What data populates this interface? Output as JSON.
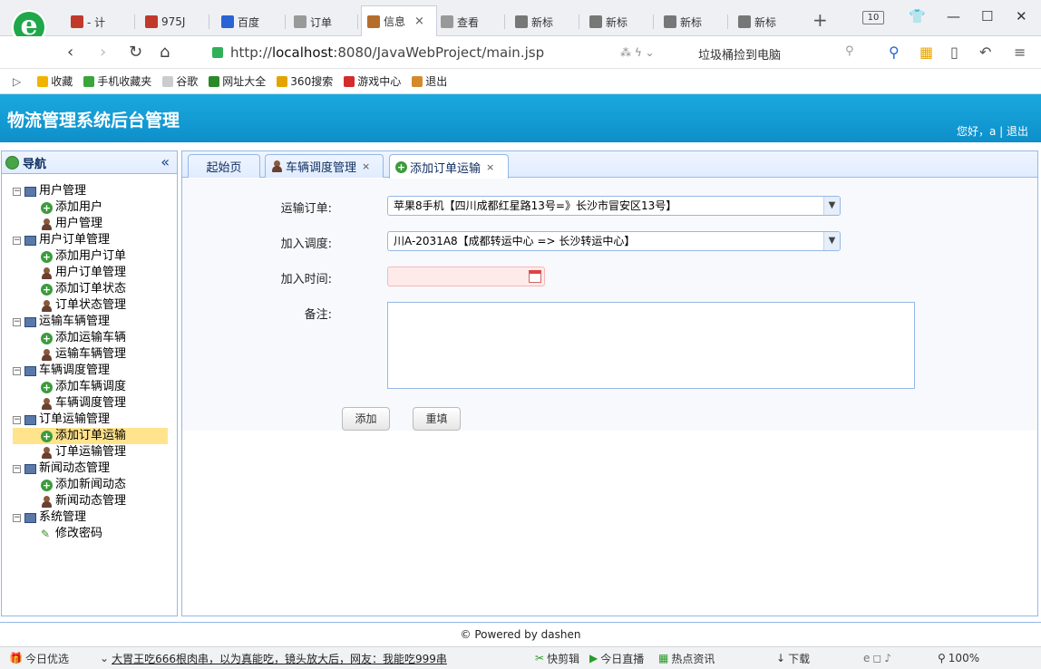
{
  "browser": {
    "tabs": [
      {
        "label": "- 计",
        "color": "#c0392b"
      },
      {
        "label": "975J",
        "color": "#c0392b"
      },
      {
        "label": "百度",
        "color": "#2a63d5"
      },
      {
        "label": "订单",
        "color": "#999999"
      },
      {
        "label": "信息",
        "color": "#b76d2a",
        "close": "×"
      },
      {
        "label": "查看",
        "color": "#999999"
      },
      {
        "label": "新标",
        "color": "#777777"
      },
      {
        "label": "新标",
        "color": "#777777"
      },
      {
        "label": "新标",
        "color": "#777777"
      },
      {
        "label": "新标",
        "color": "#777777"
      }
    ],
    "new_tab": "+",
    "tab_count": "10",
    "url_prefix": "http://",
    "url_host": "localhost",
    "url_rest": ":8080/JavaWebProject/main.jsp",
    "suggestion": "垃圾桶捡到电脑",
    "logo_letter": "e"
  },
  "bookmarks": [
    {
      "label": "收藏",
      "icon": "star-icon",
      "color": "#f0b400"
    },
    {
      "label": "手机收藏夹",
      "icon": "phone-icon",
      "color": "#3aa53a"
    },
    {
      "label": "谷歌",
      "icon": "page-icon",
      "color": "#cccccc"
    },
    {
      "label": "网址大全",
      "icon": "globe-icon",
      "color": "#2a8a2a"
    },
    {
      "label": "360搜索",
      "icon": "search360-icon",
      "color": "#e3a400"
    },
    {
      "label": "游戏中心",
      "icon": "game-icon",
      "color": "#d42c2c"
    },
    {
      "label": "退出",
      "icon": "exit-icon",
      "color": "#d48a2c"
    }
  ],
  "app": {
    "title": "物流管理系统后台管理",
    "greeting": "您好，a",
    "logout": "退出"
  },
  "nav": {
    "title": "导航",
    "collapse": "«",
    "groups": [
      {
        "label": "用户管理",
        "items": [
          {
            "label": "添加用户",
            "icon": "add"
          },
          {
            "label": "用户管理",
            "icon": "user"
          }
        ]
      },
      {
        "label": "用户订单管理",
        "items": [
          {
            "label": "添加用户订单",
            "icon": "add"
          },
          {
            "label": "用户订单管理",
            "icon": "user"
          },
          {
            "label": "添加订单状态",
            "icon": "add"
          },
          {
            "label": "订单状态管理",
            "icon": "user"
          }
        ]
      },
      {
        "label": "运输车辆管理",
        "items": [
          {
            "label": "添加运输车辆",
            "icon": "add"
          },
          {
            "label": "运输车辆管理",
            "icon": "user"
          }
        ]
      },
      {
        "label": "车辆调度管理",
        "items": [
          {
            "label": "添加车辆调度",
            "icon": "add"
          },
          {
            "label": "车辆调度管理",
            "icon": "user"
          }
        ]
      },
      {
        "label": "订单运输管理",
        "items": [
          {
            "label": "添加订单运输",
            "icon": "add",
            "selected": true
          },
          {
            "label": "订单运输管理",
            "icon": "user"
          }
        ]
      },
      {
        "label": "新闻动态管理",
        "items": [
          {
            "label": "添加新闻动态",
            "icon": "add"
          },
          {
            "label": "新闻动态管理",
            "icon": "user"
          }
        ]
      },
      {
        "label": "系统管理",
        "items": [
          {
            "label": "修改密码",
            "icon": "pen"
          }
        ]
      }
    ]
  },
  "content_tabs": [
    {
      "label": "起始页"
    },
    {
      "label": "车辆调度管理",
      "close": "×"
    },
    {
      "label": "添加订单运输",
      "close": "×",
      "active": true
    }
  ],
  "form": {
    "order_label": "运输订单:",
    "order_value": "苹果8手机【四川成都红星路13号=》长沙市冒安区13号】",
    "dispatch_label": "加入调度:",
    "dispatch_value": "川A-2031A8【成都转运中心 => 长沙转运中心】",
    "time_label": "加入时间:",
    "time_value": "",
    "remark_label": "备注:",
    "remark_value": "",
    "add_button": "添加",
    "reset_button": "重填"
  },
  "footer": "© Powered by dashen",
  "statusbar": {
    "today": "今日优选",
    "news": "大胃王吃666根肉串，以为真能吃，镜头放大后，网友：我能吃999串",
    "video": "快剪辑",
    "live": "今日直播",
    "hot": "热点资讯",
    "download": "下载",
    "zoom": "100%"
  }
}
